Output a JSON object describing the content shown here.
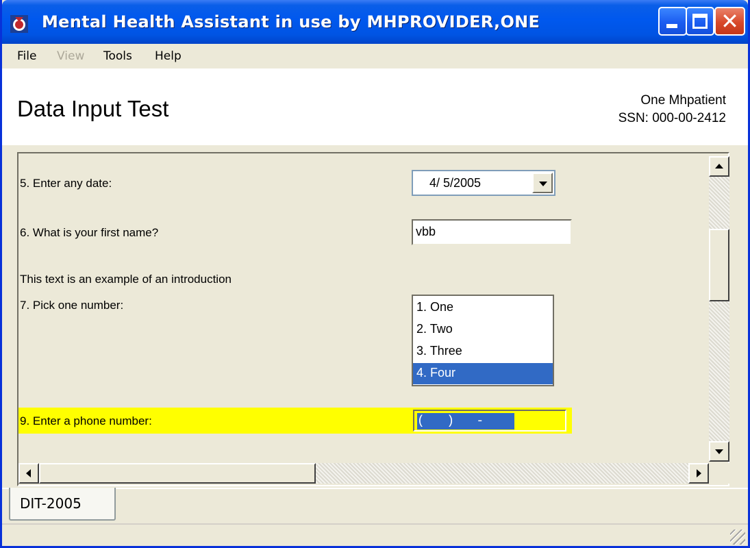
{
  "window": {
    "title": "Mental Health Assistant in use by MHPROVIDER,ONE",
    "icon": "app-shield-icon"
  },
  "menu": {
    "items": [
      {
        "label": "File",
        "enabled": true
      },
      {
        "label": "View",
        "enabled": false
      },
      {
        "label": "Tools",
        "enabled": true
      },
      {
        "label": "Help",
        "enabled": true
      }
    ]
  },
  "header": {
    "title": "Data Input Test",
    "patient_name": "One Mhpatient",
    "patient_ssn": "SSN: 000-00-2412"
  },
  "questions": {
    "q5": {
      "label": "5. Enter any date:",
      "value": "4/ 5/2005"
    },
    "q6": {
      "label": "6. What is your first name?",
      "value": "vbb"
    },
    "intro": "This text is an example of an introduction",
    "q7": {
      "label": "7. Pick one number:",
      "options": [
        "1. One",
        "2. Two",
        "3. Three",
        "4. Four"
      ],
      "selected_index": 3
    },
    "q9": {
      "label": "9. Enter a phone number:",
      "value": "(   )   -    ",
      "highlight_color": "#ffff00"
    }
  },
  "tabs": [
    {
      "label": "DIT-2005",
      "active": true
    }
  ],
  "colors": {
    "titlebar": "#0054e3",
    "selection": "#316ac5",
    "highlight": "#ffff00",
    "face": "#ece9d8"
  }
}
